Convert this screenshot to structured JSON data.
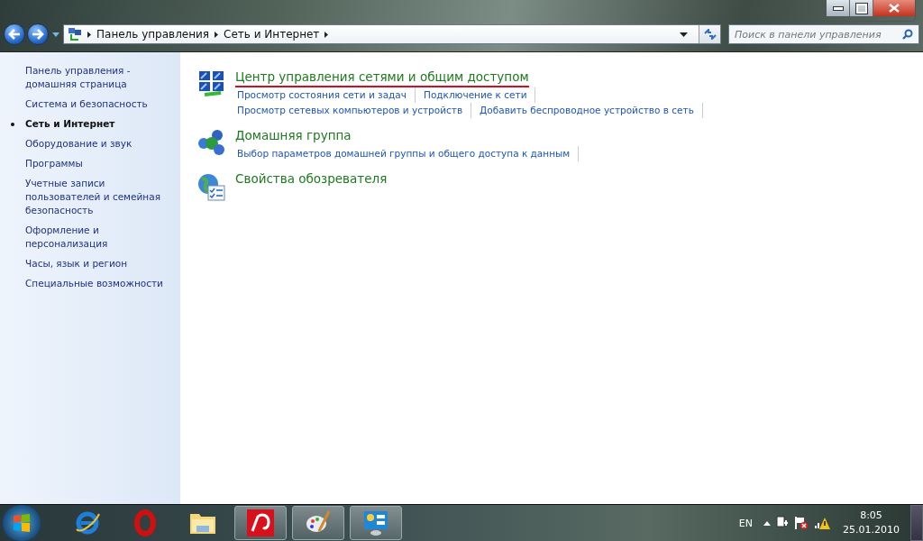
{
  "address_bar": {
    "breadcrumb": [
      "Панель управления",
      "Сеть и Интернет"
    ]
  },
  "search": {
    "placeholder": "Поиск в панели управления"
  },
  "sidebar": {
    "items": [
      {
        "label": "Панель управления - домашняя страница",
        "selected": false
      },
      {
        "label": "Система и безопасность",
        "selected": false
      },
      {
        "label": "Сеть и Интернет",
        "selected": true
      },
      {
        "label": "Оборудование и звук",
        "selected": false
      },
      {
        "label": "Программы",
        "selected": false
      },
      {
        "label": "Учетные записи пользователей и семейная безопасность",
        "selected": false
      },
      {
        "label": "Оформление и персонализация",
        "selected": false
      },
      {
        "label": "Часы, язык и регион",
        "selected": false
      },
      {
        "label": "Специальные возможности",
        "selected": false
      }
    ]
  },
  "categories": [
    {
      "kind": "network",
      "title": "Центр управления сетями и общим доступом",
      "underlined": true,
      "link_rows": [
        [
          "Просмотр состояния сети и задач",
          "Подключение к сети"
        ],
        [
          "Просмотр сетевых компьютеров и устройств",
          "Добавить беспроводное устройство в сеть"
        ]
      ]
    },
    {
      "kind": "homegroup",
      "title": "Домашняя группа",
      "underlined": false,
      "link_rows": [
        [
          "Выбор параметров домашней группы и общего доступа к данным"
        ]
      ]
    },
    {
      "kind": "browser",
      "title": "Свойства обозревателя",
      "underlined": false
    }
  ],
  "taskbar": {
    "apps": [
      {
        "kind": "explorer-e",
        "running": false
      },
      {
        "kind": "opera",
        "running": false
      },
      {
        "kind": "folder",
        "running": false
      },
      {
        "kind": "antivirus",
        "running": true
      },
      {
        "kind": "paint",
        "running": true
      },
      {
        "kind": "panel",
        "running": true
      }
    ],
    "language": "EN",
    "time": "8:05",
    "date": "25.01.2010"
  }
}
